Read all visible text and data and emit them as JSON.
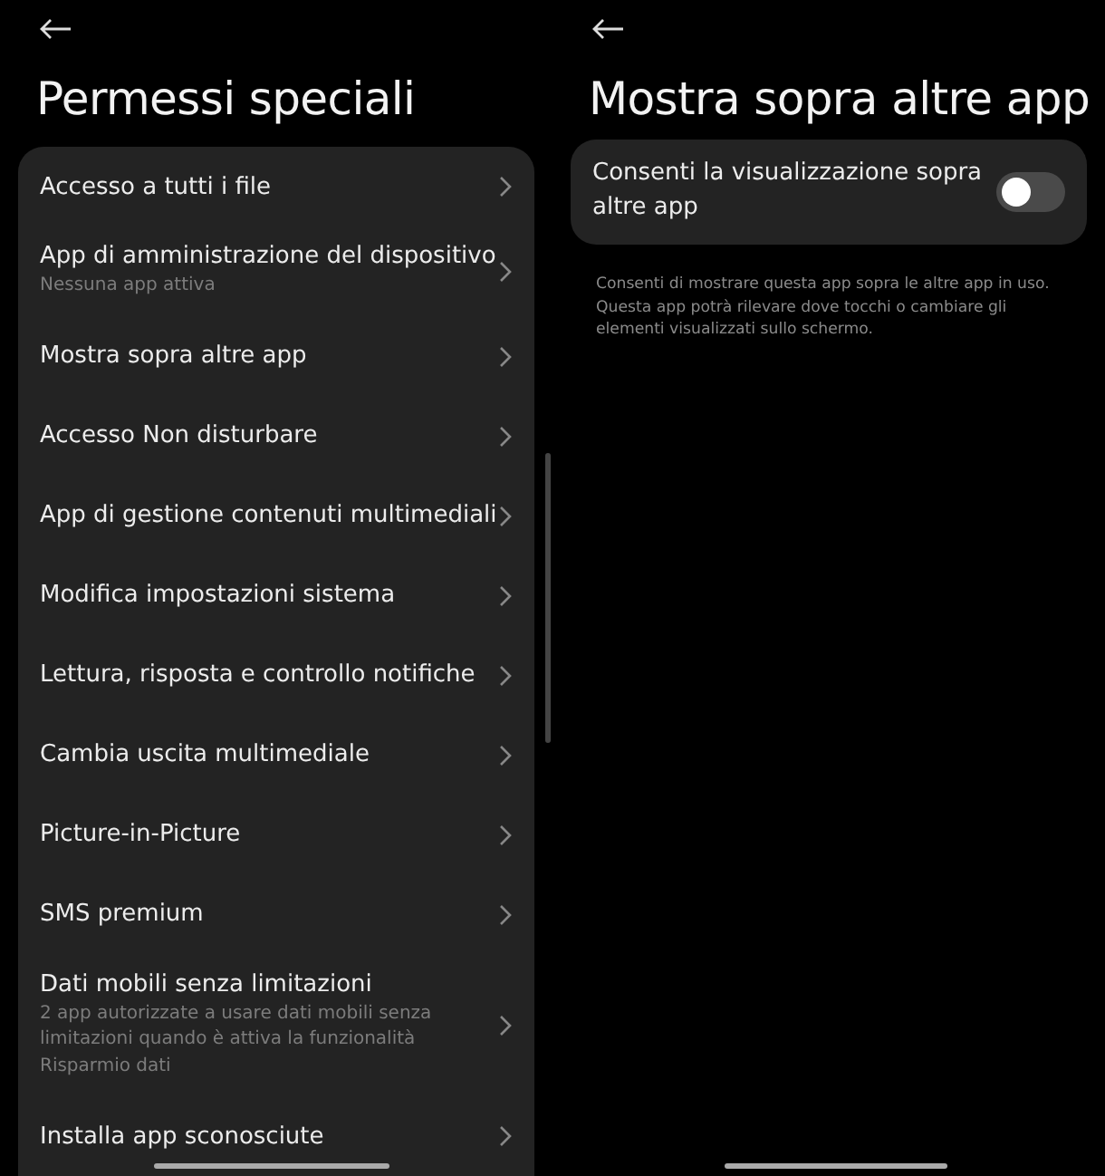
{
  "left_screen": {
    "title": "Permessi speciali",
    "items": [
      {
        "label": "Accesso a tutti i file"
      },
      {
        "label": "App di amministrazione del dispositivo",
        "subtitle": "Nessuna app attiva"
      },
      {
        "label": "Mostra sopra altre app"
      },
      {
        "label": "Accesso Non disturbare"
      },
      {
        "label": "App di gestione contenuti multimediali"
      },
      {
        "label": "Modifica impostazioni sistema"
      },
      {
        "label": "Lettura, risposta e controllo notifiche"
      },
      {
        "label": "Cambia uscita multimediale"
      },
      {
        "label": "Picture-in-Picture"
      },
      {
        "label": "SMS premium"
      },
      {
        "label": "Dati mobili senza limitazioni",
        "subtitle": "2 app autorizzate a usare dati mobili senza limitazioni quando è attiva la funzionalità Risparmio dati"
      },
      {
        "label": "Installa app sconosciute"
      }
    ]
  },
  "right_screen": {
    "title": "Mostra sopra altre app",
    "setting": {
      "label": "Consenti la visualizzazione sopra altre app",
      "on": false
    },
    "description": "Consenti di mostrare questa app sopra le altre app in uso. Questa app potrà rilevare dove tocchi o cambiare gli elementi visualizzati sullo schermo."
  }
}
